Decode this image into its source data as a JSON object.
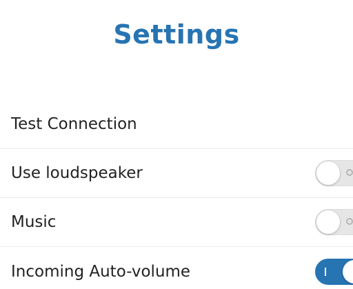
{
  "header": {
    "title": "Settings"
  },
  "settings": [
    {
      "label": "Test Connection"
    },
    {
      "label": "Use loudspeaker",
      "toggle": "off"
    },
    {
      "label": "Music",
      "toggle": "off"
    },
    {
      "label": "Incoming Auto-volume",
      "toggle": "on"
    }
  ],
  "colors": {
    "accent": "#2774b3",
    "toggle_off": "#e6e6e6",
    "text": "#222222"
  }
}
